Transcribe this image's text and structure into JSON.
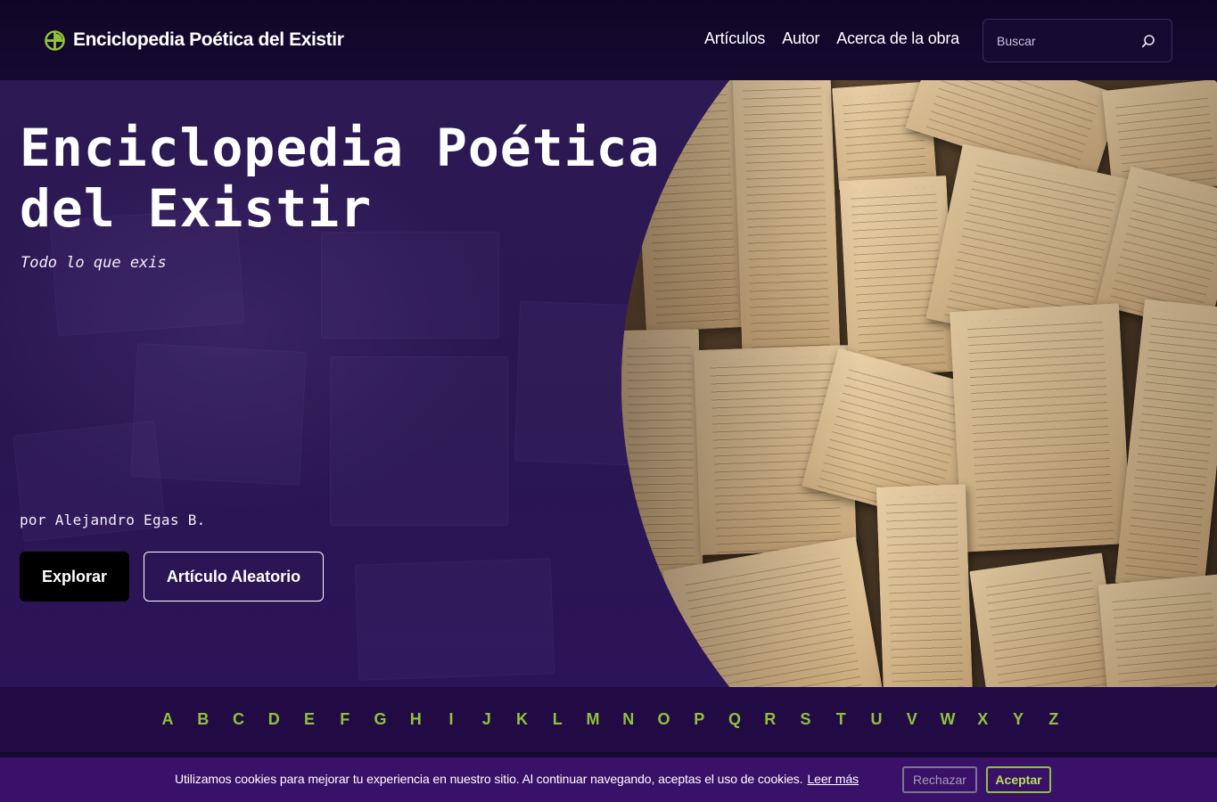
{
  "header": {
    "brand_name": "Enciclopedia Poética del Existir",
    "nav": [
      {
        "label": "Artículos"
      },
      {
        "label": "Autor"
      },
      {
        "label": "Acerca de la obra"
      }
    ],
    "search": {
      "placeholder": "Buscar",
      "value": ""
    }
  },
  "hero": {
    "title": "Enciclopedia Poética del Existir",
    "subtitle": "Todo lo que exis",
    "author": "por Alejandro Egas B.",
    "explore_label": "Explorar",
    "random_label": "Artículo Aleatorio"
  },
  "alphabet": [
    "A",
    "B",
    "C",
    "D",
    "E",
    "F",
    "G",
    "H",
    "I",
    "J",
    "K",
    "L",
    "M",
    "N",
    "O",
    "P",
    "Q",
    "R",
    "S",
    "T",
    "U",
    "V",
    "W",
    "X",
    "Y",
    "Z"
  ],
  "cookies": {
    "message": "Utilizamos cookies para mejorar tu experiencia en nuestro sitio. Al continuar navegando, aceptas el uso de cookies.",
    "link_label": "Leer más",
    "reject_label": "Rechazar",
    "accept_label": "Aceptar"
  },
  "colors": {
    "accent_green": "#8fc23a",
    "background": "#110828",
    "hero_purple": "#2b1752",
    "cookie_bar": "#3a1168"
  },
  "icons": {
    "brand": "plus-leaf-logo-icon",
    "search": "search-icon"
  }
}
